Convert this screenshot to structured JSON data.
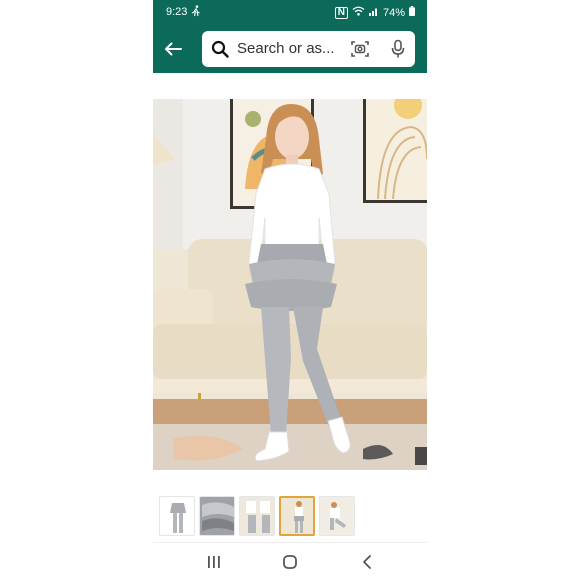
{
  "status_bar": {
    "time": "9:23",
    "battery": "74%"
  },
  "search": {
    "placeholder": "Search or as..."
  },
  "product": {
    "selected_thumbnail_index": 3,
    "thumbnail_count": 5
  },
  "colors": {
    "header": "#0c6a5a",
    "selected_thumb_border": "#e2a53a"
  },
  "icons": [
    "walking-icon",
    "nfc-icon",
    "wifi-icon",
    "signal-icon",
    "battery-icon",
    "back-arrow-icon",
    "search-icon",
    "camera-icon",
    "microphone-icon",
    "recent-apps-icon",
    "home-icon",
    "back-nav-icon"
  ]
}
